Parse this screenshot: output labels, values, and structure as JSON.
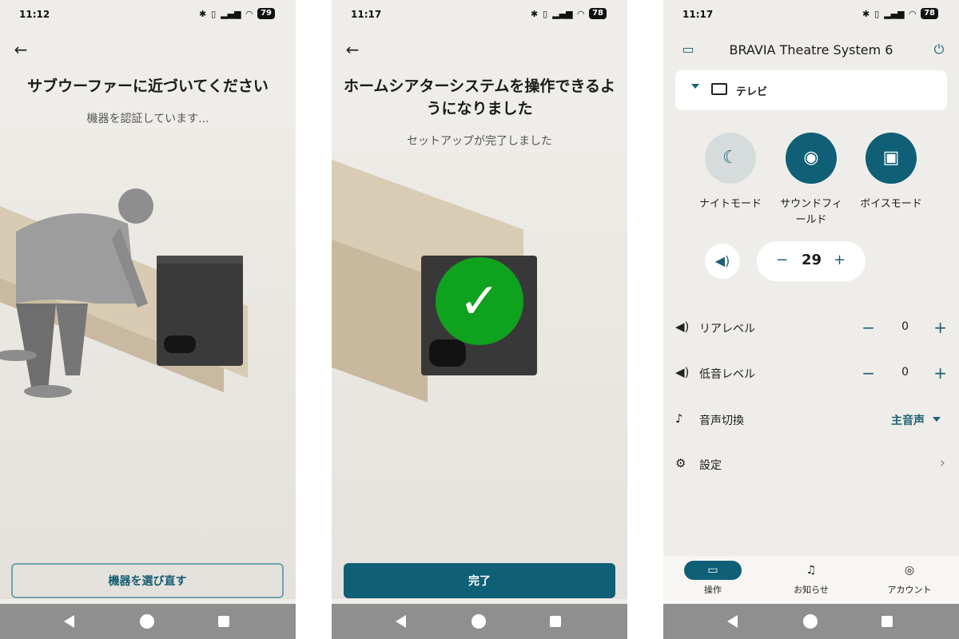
{
  "status_bar": [
    {
      "time": "11:12",
      "battery": "79"
    },
    {
      "time": "11:17",
      "battery": "78"
    },
    {
      "time": "11:17",
      "battery": "78"
    }
  ],
  "screen1": {
    "title": "サブウーファーに近づいてください",
    "subtitle": "機器を認証しています...",
    "button": "機器を選び直す"
  },
  "screen2": {
    "title": "ホームシアターシステムを操作できるようになりました",
    "subtitle": "セットアップが完了しました",
    "button": "完了"
  },
  "screen3": {
    "device_name": "BRAVIA Theatre System 6",
    "input_source": "テレビ",
    "modes": [
      {
        "label": "ナイトモード",
        "active": false
      },
      {
        "label": "サウンドフィールド",
        "active": true
      },
      {
        "label": "ボイスモード",
        "active": true
      }
    ],
    "volume": {
      "value": "29",
      "minus": "−",
      "plus": "+"
    },
    "settings_rows": [
      {
        "label": "リアレベル",
        "value": "0"
      },
      {
        "label": "低音レベル",
        "value": "0"
      }
    ],
    "audio_switch": {
      "label": "音声切換",
      "value": "主音声"
    },
    "settings_label": "設定",
    "bottom_nav": [
      {
        "label": "操作",
        "active": true
      },
      {
        "label": "お知らせ",
        "active": false
      },
      {
        "label": "アカウント",
        "active": false
      }
    ]
  },
  "colors": {
    "accent": "#0f5f76",
    "success": "#0fa21f",
    "background": "#efede9"
  },
  "icons": [
    "back-arrow-icon",
    "bluetooth-icon",
    "wifi-icon",
    "battery-icon",
    "tv-icon",
    "power-icon",
    "moon-icon",
    "sound-field-icon",
    "voice-icon",
    "speaker-icon",
    "music-note-icon",
    "gear-icon",
    "bell-icon",
    "account-icon",
    "check-icon"
  ]
}
